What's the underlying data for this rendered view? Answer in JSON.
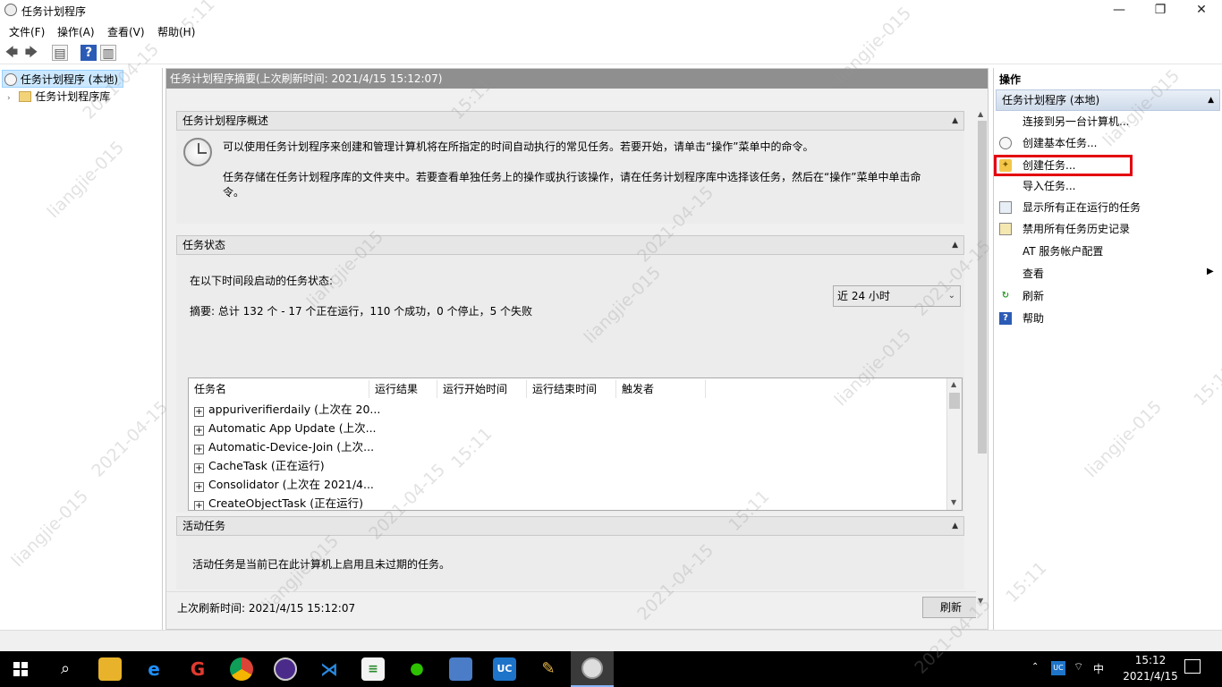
{
  "window": {
    "title": "任务计划程序",
    "minimize": "—",
    "restore": "❐",
    "close": "✕"
  },
  "menu": [
    "文件(F)",
    "操作(A)",
    "查看(V)",
    "帮助(H)"
  ],
  "tree": {
    "root": "任务计划程序 (本地)",
    "library": "任务计划程序库"
  },
  "center": {
    "header": "任务计划程序摘要(上次刷新时间: 2021/4/15 15:12:07)",
    "overview": {
      "title": "任务计划程序概述",
      "line1": "可以使用任务计划程序来创建和管理计算机将在所指定的时间自动执行的常见任务。若要开始，请单击“操作”菜单中的命令。",
      "line2a": "任务存储在任务计划程序库的文件夹中。若要查看单独任务上的操作或执行该操作，请在任务计划程序库中选择该任务，然后在“操作”菜单中单击命",
      "line2b": "令。"
    },
    "status": {
      "title": "任务状态",
      "label": "在以下时间段启动的任务状态:",
      "range": "近 24 小时",
      "summary": "摘要: 总计 132 个 - 17 个正在运行，110 个成功，0 个停止，5 个失败",
      "columns": [
        "任务名",
        "运行结果",
        "运行开始时间",
        "运行结束时间",
        "触发者"
      ],
      "rows": [
        "appuriverifierdaily (上次在 20...",
        "Automatic App Update (上次...",
        "Automatic-Device-Join (上次...",
        "CacheTask (正在运行)",
        "Consolidator (上次在 2021/4...",
        "CreateObjectTask (正在运行)"
      ]
    },
    "active": {
      "title": "活动任务",
      "text": "活动任务是当前已在此计算机上启用且未过期的任务。"
    },
    "last_refresh": "上次刷新时间: 2021/4/15 15:12:07",
    "refresh_button": "刷新"
  },
  "actions": {
    "title": "操作",
    "group": "任务计划程序 (本地)",
    "items": [
      {
        "label": "连接到另一台计算机...",
        "icon": ""
      },
      {
        "label": "创建基本任务...",
        "icon": "basic-task-icon"
      },
      {
        "label": "创建任务...",
        "icon": "create-task-icon"
      },
      {
        "label": "导入任务...",
        "icon": ""
      },
      {
        "label": "显示所有正在运行的任务",
        "icon": "running-tasks-icon"
      },
      {
        "label": "禁用所有任务历史记录",
        "icon": "history-icon"
      },
      {
        "label": "AT 服务帐户配置",
        "icon": ""
      },
      {
        "label": "查看",
        "icon": ""
      },
      {
        "label": "刷新",
        "icon": "refresh-icon"
      },
      {
        "label": "帮助",
        "icon": "help-icon"
      }
    ]
  },
  "taskbar": {
    "time": "15:12",
    "date": "2021/4/15",
    "ime": "中"
  },
  "watermark": {
    "name": "liangjie-015",
    "date": "2021-04-15",
    "time": "15:11"
  },
  "colors": {
    "highlight": "#e3000f",
    "center_header": "#8f8f8f",
    "taskbar": "#000000"
  }
}
